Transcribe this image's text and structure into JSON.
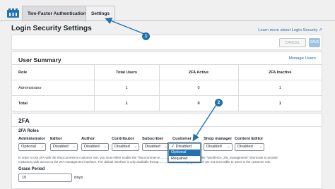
{
  "tabs": [
    {
      "label": "Two-Factor Authentication",
      "active": false
    },
    {
      "label": "Settings",
      "active": true
    }
  ],
  "page_title": "Login Security Settings",
  "learn_link": "Learn more about Login Security",
  "actions": {
    "cancel": "CANCEL",
    "save": "SAVE"
  },
  "summary": {
    "title": "User Summary",
    "manage_link": "Manage Users",
    "columns": [
      "Role",
      "Total Users",
      "2FA Active",
      "2FA Inactive"
    ],
    "rows": [
      [
        "Administrator",
        "1",
        "0",
        "1"
      ],
      [
        "Total",
        "1",
        "0",
        "1"
      ]
    ]
  },
  "twofa": {
    "title": "2FA",
    "roles_title": "2FA Roles",
    "roles": [
      {
        "label": "Administrator",
        "value": "Optional"
      },
      {
        "label": "Editor",
        "value": "Disabled"
      },
      {
        "label": "Author",
        "value": "Disabled"
      },
      {
        "label": "Contributor",
        "value": "Disabled"
      },
      {
        "label": "Subscriber",
        "value": "Disabled"
      },
      {
        "label": "Customer",
        "value": ""
      },
      {
        "label": "Shop manager",
        "value": "Disabled"
      },
      {
        "label": "Content Editor",
        "value": "Disabled"
      }
    ],
    "help_line1": "In order to use 2FA with the WooCommerce customer role, you must either enable the \"WooCommerce ...........................ation or use the \"wordfence_2fa_management\" shortcode to provide",
    "help_line2": "customers with access to the 2FA management interface. The default interface is only available throug..............................n pages which are not accessible to users in the customer role.",
    "grace_label": "Grace Period",
    "grace_value": "10",
    "grace_unit": "days"
  },
  "customer_dropdown": {
    "options": [
      "✓ Disabled",
      "Optional",
      "Required"
    ],
    "highlighted": 1
  },
  "annotations": [
    "1",
    "2"
  ],
  "colors": {
    "accent": "#2271b1",
    "save_disabled": "#9ec2e6",
    "background": "#f0f0f1"
  }
}
